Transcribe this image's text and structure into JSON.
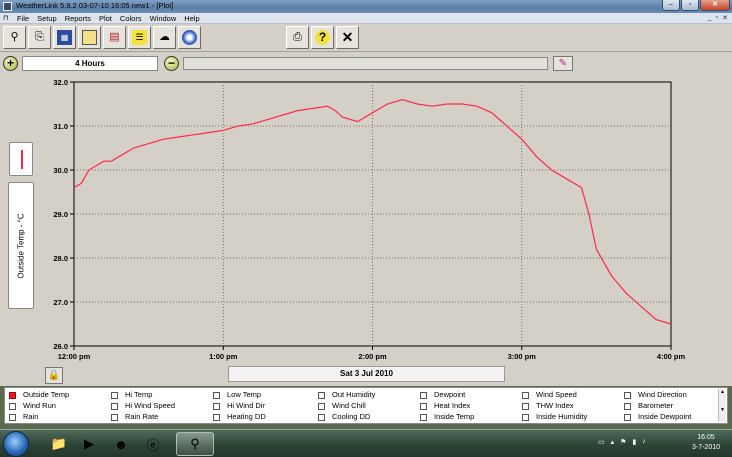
{
  "window": {
    "title": "WeatherLink 5.9.2  03-07-10  16:05  new1 - [Plot]"
  },
  "menu": [
    "File",
    "Setup",
    "Reports",
    "Plot",
    "Colors",
    "Window",
    "Help"
  ],
  "span": {
    "label": "4 Hours",
    "zoom_in": "+",
    "zoom_out": "−"
  },
  "plot": {
    "date_label": "Sat 3 Jul 2010",
    "y_axis_label": "Outside Temp - °C",
    "line_color": "#ff2a4a"
  },
  "chart_data": {
    "type": "line",
    "ylabel": "Outside Temp - °C",
    "xlabel": "Sat 3 Jul 2010",
    "ylim": [
      26.0,
      32.0
    ],
    "y_ticks": [
      "26.0",
      "27.0",
      "28.0",
      "29.0",
      "30.0",
      "31.0",
      "32.0"
    ],
    "x_ticks": [
      "12:00 pm",
      "1:00 pm",
      "2:00 pm",
      "3:00 pm",
      "4:00 pm"
    ],
    "grid": true,
    "series": [
      {
        "x_hours": [
          0,
          0.05,
          0.1,
          0.15,
          0.2,
          0.25,
          0.3,
          0.4,
          0.5,
          0.6,
          0.7,
          0.8,
          0.9,
          1.0,
          1.1,
          1.2,
          1.3,
          1.4,
          1.5,
          1.6,
          1.7,
          1.75,
          1.8,
          1.9,
          2.0,
          2.1,
          2.2,
          2.3,
          2.4,
          2.5,
          2.6,
          2.7,
          2.8,
          2.9,
          3.0,
          3.1,
          3.2,
          3.3,
          3.4,
          3.45,
          3.5,
          3.6,
          3.7,
          3.8,
          3.9,
          4.0
        ],
        "values": [
          29.6,
          29.7,
          30.0,
          30.1,
          30.2,
          30.2,
          30.3,
          30.5,
          30.6,
          30.7,
          30.75,
          30.8,
          30.85,
          30.9,
          31.0,
          31.05,
          31.15,
          31.25,
          31.35,
          31.4,
          31.45,
          31.35,
          31.2,
          31.1,
          31.3,
          31.5,
          31.6,
          31.5,
          31.45,
          31.5,
          31.5,
          31.45,
          31.3,
          31.0,
          30.7,
          30.3,
          30.0,
          29.8,
          29.6,
          29.0,
          28.2,
          27.6,
          27.2,
          26.9,
          26.6,
          26.5
        ]
      }
    ]
  },
  "variables": [
    {
      "label": "Outside Temp",
      "checked": true
    },
    {
      "label": "Hi Temp",
      "checked": false
    },
    {
      "label": "Low Temp",
      "checked": false
    },
    {
      "label": "Out Humidity",
      "checked": false
    },
    {
      "label": "Dewpoint",
      "checked": false
    },
    {
      "label": "Wind Speed",
      "checked": false
    },
    {
      "label": "Wind Direction",
      "checked": false
    },
    {
      "label": "Wind Run",
      "checked": false
    },
    {
      "label": "Hi Wind Speed",
      "checked": false
    },
    {
      "label": "Hi Wind Dir",
      "checked": false
    },
    {
      "label": "Wind Chill",
      "checked": false
    },
    {
      "label": "Heat Index",
      "checked": false
    },
    {
      "label": "THW Index",
      "checked": false
    },
    {
      "label": "Barometer",
      "checked": false
    },
    {
      "label": "Rain",
      "checked": false
    },
    {
      "label": "Rain Rate",
      "checked": false
    },
    {
      "label": "Heating DD",
      "checked": false
    },
    {
      "label": "Cooling DD",
      "checked": false
    },
    {
      "label": "Inside Temp",
      "checked": false
    },
    {
      "label": "Inside Humidity",
      "checked": false
    },
    {
      "label": "Inside Dewpoint",
      "checked": false
    }
  ],
  "toolbar_icons": [
    "weather-station-icon",
    "download-icon",
    "bulletin-icon",
    "browse-icon",
    "plot-icon",
    "strip-chart-icon",
    "summary-icon",
    "forecast-cloud-icon",
    "noaa-icon"
  ],
  "taskbar": {
    "time": "16:05",
    "date": "3-7-2010"
  }
}
